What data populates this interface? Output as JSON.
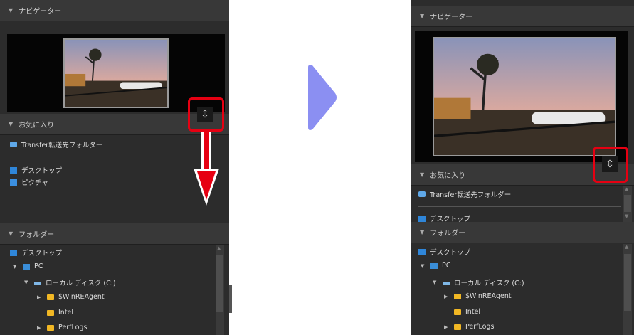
{
  "before": {
    "navigator_header": "ナビゲーター",
    "favorites_header": "お気に入り",
    "favorites": [
      {
        "label": "Transfer転送先フォルダー",
        "icon": "transfer-icon"
      },
      {
        "label": "デスクトップ",
        "icon": "desktop-icon"
      },
      {
        "label": "ピクチャ",
        "icon": "pictures-icon"
      }
    ],
    "folders_header": "フォルダー",
    "folders": [
      {
        "label": "デスクトップ",
        "icon": "desktop-icon",
        "expander": ""
      },
      {
        "label": "PC",
        "icon": "pc-icon",
        "expander": "▼"
      },
      {
        "label": "ローカル ディスク (C:)",
        "icon": "drive-icon",
        "expander": "▼"
      },
      {
        "label": "$WinREAgent",
        "icon": "folder-icon",
        "expander": "▶"
      },
      {
        "label": "Intel",
        "icon": "folder-icon",
        "expander": ""
      },
      {
        "label": "PerfLogs",
        "icon": "folder-icon",
        "expander": "▶"
      }
    ],
    "handle_glyph": "⇳"
  },
  "after": {
    "navigator_header": "ナビゲーター",
    "favorites_header": "お気に入り",
    "favorites": [
      {
        "label": "Transfer転送先フォルダー",
        "icon": "transfer-icon"
      },
      {
        "label": "デスクトップ",
        "icon": "desktop-icon"
      }
    ],
    "folders_header": "フォルダー",
    "folders": [
      {
        "label": "デスクトップ",
        "icon": "desktop-icon",
        "expander": ""
      },
      {
        "label": "PC",
        "icon": "pc-icon",
        "expander": "▼"
      },
      {
        "label": "ローカル ディスク (C:)",
        "icon": "drive-icon",
        "expander": "▼"
      },
      {
        "label": "$WinREAgent",
        "icon": "folder-icon",
        "expander": "▶"
      },
      {
        "label": "Intel",
        "icon": "folder-icon",
        "expander": ""
      },
      {
        "label": "PerfLogs",
        "icon": "folder-icon",
        "expander": "▶"
      }
    ],
    "handle_glyph": "⇳"
  },
  "colors": {
    "highlight": "#e60012",
    "next_arrow": "#8b8ff2",
    "panel_bg": "#2c2c2c",
    "header_bg": "#383838"
  }
}
